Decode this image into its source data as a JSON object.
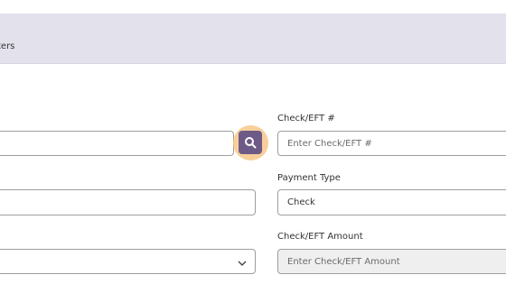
{
  "header": {
    "title_fragment": "ters"
  },
  "check_eft_number": {
    "label": "Check/EFT #",
    "placeholder": "Enter Check/EFT #"
  },
  "payment_type": {
    "label": "Payment Type",
    "value": "Check"
  },
  "check_eft_amount": {
    "label": "Check/EFT Amount",
    "placeholder": "Enter Check/EFT Amount"
  },
  "icons": {
    "search": "search-icon",
    "dropdown": "chevron-down-icon"
  },
  "colors": {
    "header_bg": "#e2e1ec",
    "search_button": "#6e5a87",
    "search_highlight": "#f7c78a",
    "readonly_bg": "#efefef"
  }
}
